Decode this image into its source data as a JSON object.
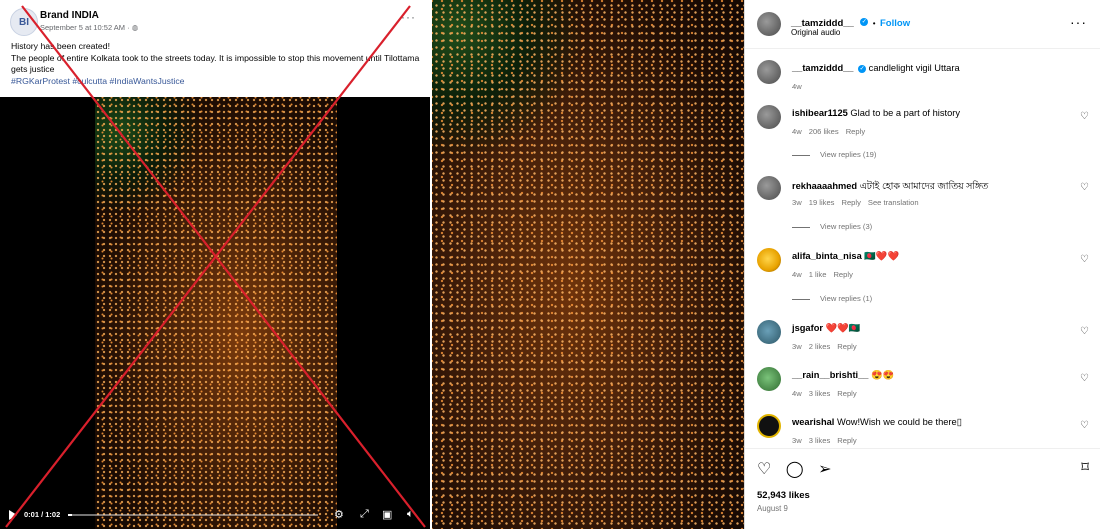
{
  "facebook": {
    "page_name": "Brand INDIA",
    "timestamp": "September 5 at 10:52 AM · ",
    "avatar_text": "BI",
    "post_line1": "History has been created!",
    "post_line2": "The people of entire Kolkata took to the streets today. It is impossible to stop this movement until Tilottama gets justice",
    "hashtags": "#RGKarProtest #culcutta #IndiaWantsJustice",
    "video_time": "0:01 / 1:02",
    "video_progress": 0.016,
    "crossed_out_color": "#d9202c"
  },
  "instagram": {
    "header_user": "__tamziddd__",
    "follow_label": "Follow",
    "audio": "Original audio",
    "caption_user": "__tamziddd__",
    "caption_text": "candlelight vigil Uttara",
    "caption_age": "4w",
    "comments": [
      {
        "user": "ishibear1125",
        "text": "Glad to be a part of history",
        "age": "4w",
        "likes": "206 likes",
        "reply": "Reply",
        "extra": "",
        "view_replies": "View replies (19)"
      },
      {
        "user": "rekhaaaahmed",
        "text": "এটাই হোক আমাদের জাতিয় সঙ্গিত",
        "age": "3w",
        "likes": "19 likes",
        "reply": "Reply",
        "extra": "See translation",
        "view_replies": "View replies (3)"
      },
      {
        "user": "alifa_binta_nisa",
        "text": "🇧🇩❤️❤️",
        "age": "4w",
        "likes": "1 like",
        "reply": "Reply",
        "extra": "",
        "view_replies": "View replies (1)"
      },
      {
        "user": "jsgafor",
        "text": "❤️❤️🇧🇩",
        "age": "3w",
        "likes": "2 likes",
        "reply": "Reply",
        "extra": "",
        "view_replies": ""
      },
      {
        "user": "__rain__brishti__",
        "text": "😍😍",
        "age": "4w",
        "likes": "3 likes",
        "reply": "Reply",
        "extra": "",
        "view_replies": ""
      },
      {
        "user": "wearishal",
        "text": "Wow!Wish we could be there▯",
        "age": "3w",
        "likes": "3 likes",
        "reply": "Reply",
        "extra": "",
        "view_replies": ""
      }
    ],
    "likes_total": "52,943 likes",
    "post_date": "August 9",
    "icons": [
      "heart-icon",
      "comment-icon",
      "share-icon",
      "bookmark-icon"
    ]
  }
}
